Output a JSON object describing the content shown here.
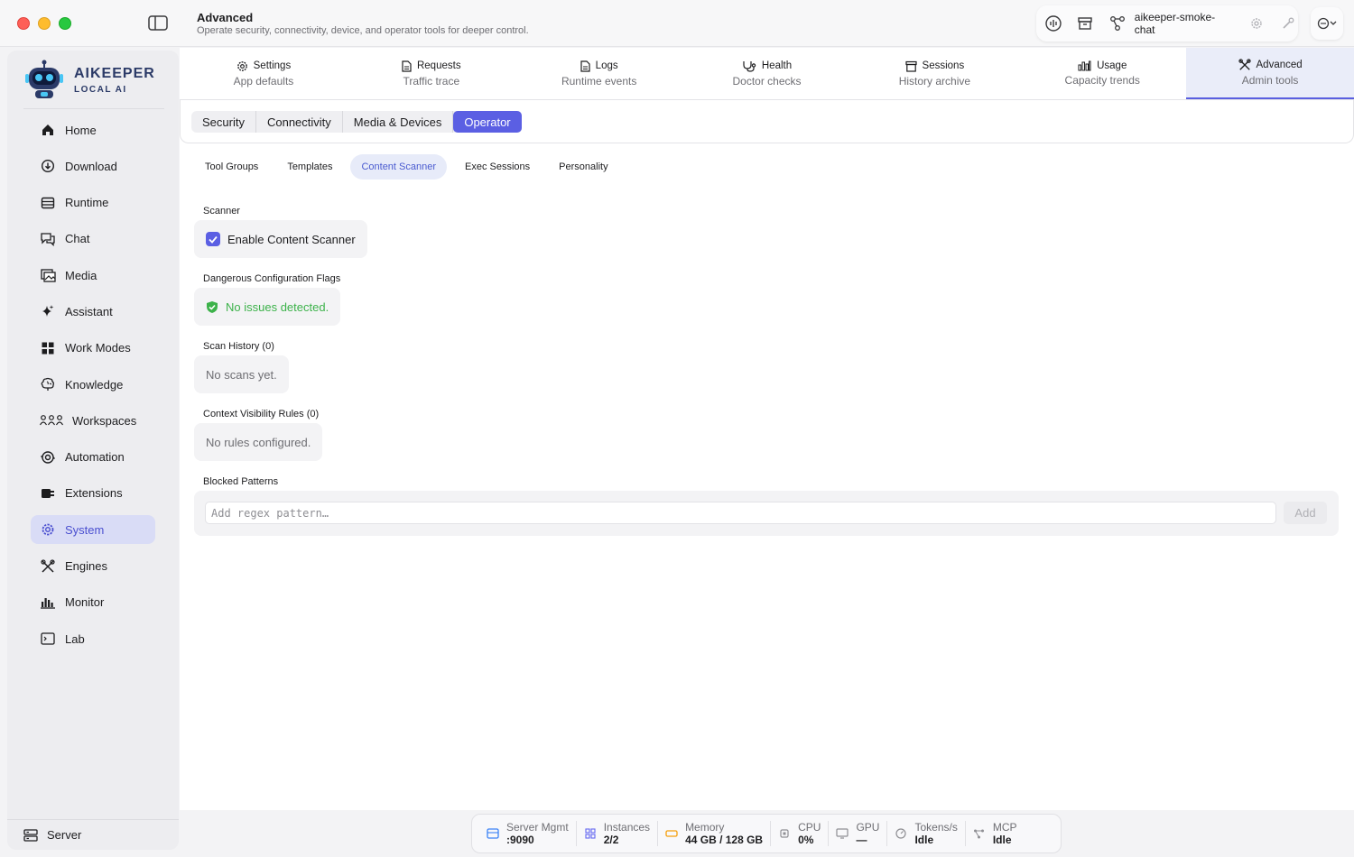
{
  "header": {
    "title": "Advanced",
    "subtitle": "Operate security, connectivity, device, and operator tools for deeper control.",
    "chat_name": "aikeeper-smoke-chat"
  },
  "brand": {
    "name": "AIKEEPER",
    "sub": "LOCAL AI"
  },
  "sidebar": {
    "items": [
      {
        "label": "Home",
        "icon": "home-icon"
      },
      {
        "label": "Download",
        "icon": "download-icon"
      },
      {
        "label": "Runtime",
        "icon": "runtime-icon"
      },
      {
        "label": "Chat",
        "icon": "chat-icon"
      },
      {
        "label": "Media",
        "icon": "media-icon"
      },
      {
        "label": "Assistant",
        "icon": "sparkle-icon"
      },
      {
        "label": "Work Modes",
        "icon": "grid-icon"
      },
      {
        "label": "Knowledge",
        "icon": "brain-icon"
      },
      {
        "label": "Workspaces",
        "icon": "people-icon"
      },
      {
        "label": "Automation",
        "icon": "automation-icon"
      },
      {
        "label": "Extensions",
        "icon": "plug-icon"
      },
      {
        "label": "System",
        "icon": "gear-icon",
        "active": true
      },
      {
        "label": "Engines",
        "icon": "tools-icon"
      },
      {
        "label": "Monitor",
        "icon": "bar-chart-icon"
      },
      {
        "label": "Lab",
        "icon": "terminal-icon"
      }
    ],
    "bottom": "Server"
  },
  "tabs": [
    {
      "label": "Settings",
      "sub": "App defaults"
    },
    {
      "label": "Requests",
      "sub": "Traffic trace"
    },
    {
      "label": "Logs",
      "sub": "Runtime events"
    },
    {
      "label": "Health",
      "sub": "Doctor checks"
    },
    {
      "label": "Sessions",
      "sub": "History archive"
    },
    {
      "label": "Usage",
      "sub": "Capacity trends"
    },
    {
      "label": "Advanced",
      "sub": "Admin tools",
      "active": true
    }
  ],
  "segments": [
    "Security",
    "Connectivity",
    "Media & Devices",
    "Operator"
  ],
  "segment_active": "Operator",
  "subtabs": [
    "Tool Groups",
    "Templates",
    "Content Scanner",
    "Exec Sessions",
    "Personality"
  ],
  "subtab_active": "Content Scanner",
  "scanner": {
    "label": "Scanner",
    "checkbox_label": "Enable Content Scanner",
    "checked": true
  },
  "flags": {
    "label": "Dangerous Configuration Flags",
    "status": "No issues detected."
  },
  "history": {
    "label": "Scan History (0)",
    "empty": "No scans yet."
  },
  "visibility": {
    "label": "Context Visibility Rules (0)",
    "empty": "No rules configured."
  },
  "blocked": {
    "label": "Blocked Patterns",
    "placeholder": "Add regex pattern…",
    "add_label": "Add"
  },
  "status": [
    {
      "label": "Server Mgmt",
      "value": ":9090",
      "color": "#3b82f6"
    },
    {
      "label": "Instances",
      "value": "2/2",
      "color": "#6366f1"
    },
    {
      "label": "Memory",
      "value": "44 GB / 128 GB",
      "color": "#f59e0b"
    },
    {
      "label": "CPU",
      "value": "0%",
      "color": "#8e8e93"
    },
    {
      "label": "GPU",
      "value": "—",
      "color": "#8e8e93"
    },
    {
      "label": "Tokens/s",
      "value": "Idle",
      "color": "#8e8e93"
    },
    {
      "label": "MCP",
      "value": "Idle",
      "color": "#8e8e93"
    }
  ],
  "colors": {
    "accent": "#5b5fe3",
    "ok": "#3cb24a"
  }
}
